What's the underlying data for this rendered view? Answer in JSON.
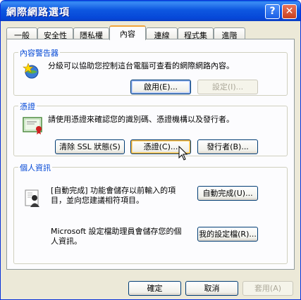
{
  "window": {
    "title": "網際網路選項",
    "help_label": "?",
    "close_label": "✕"
  },
  "tabs": [
    "一般",
    "安全性",
    "隱私權",
    "內容",
    "連線",
    "程式集",
    "進階"
  ],
  "content_advisor": {
    "label": "內容警告器",
    "description": "分級可以協助您控制這台電腦可查看的網際網路內容。",
    "enable_label": "啟用(E)...",
    "settings_label": "設定(I)..."
  },
  "certificates": {
    "label": "憑證",
    "description": "請使用憑證來確認您的識別碼、憑證機構以及發行者。",
    "clear_ssl_label": "清除 SSL 狀態(S)",
    "certificates_label": "憑證(C)...",
    "publishers_label": "發行者(B)..."
  },
  "personal_info": {
    "label": "個人資訊",
    "autocomplete_desc_line1": "[自動完成] 功能會儲存以前輸入的項",
    "autocomplete_desc_line2": "目，並向您建議相符項目。",
    "autocomplete_label": "自動完成(U)...",
    "profile_desc_line1": "Microsoft 設定檔助理員會儲存您的個",
    "profile_desc_line2": "人資訊。",
    "profile_label": "我的設定檔(R)..."
  },
  "footer": {
    "ok_label": "確定",
    "cancel_label": "取消",
    "apply_label": "套用(A)"
  },
  "colors": {
    "title_bar": "#0a56dc",
    "group_label": "#0046d5",
    "face": "#ece9d8"
  },
  "icons": [
    "help-icon",
    "close-icon",
    "rating-star-icon",
    "certificate-icon",
    "contact-card-icon",
    "mouse-cursor-icon"
  ]
}
